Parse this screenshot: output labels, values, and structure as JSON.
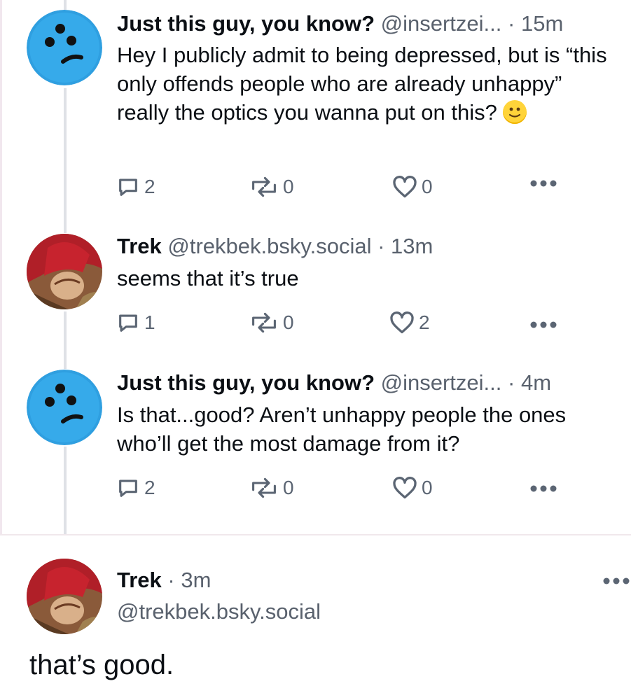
{
  "posts": [
    {
      "name": "Just this guy, you know?",
      "handle": "@insertzei...",
      "time": "15m",
      "text": "Hey I publicly admit to being depressed, but is “this only offends people who are already unhappy” really the optics you wanna put on this?",
      "replies": "2",
      "reposts": "0",
      "likes": "0"
    },
    {
      "name": "Trek",
      "handle": "@trekbek.bsky.social",
      "time": "13m",
      "text": "seems that it’s true",
      "replies": "1",
      "reposts": "0",
      "likes": "2"
    },
    {
      "name": "Just this guy, you know?",
      "handle": "@insertzei...",
      "time": "4m",
      "text": "Is that...good? Aren’t unhappy people the ones who’ll get the most damage from it?",
      "replies": "2",
      "reposts": "0",
      "likes": "0"
    }
  ],
  "focused": {
    "name": "Trek",
    "time": "3m",
    "handle": "@trekbek.bsky.social",
    "text": "that’s good."
  },
  "separator": "·",
  "icons": {
    "reply": "speech-bubble-icon",
    "repost": "repost-arrows-icon",
    "like": "heart-outline-icon",
    "more": "more-dots-icon",
    "emoji": "slightly-smiling-face-emoji"
  },
  "colors": {
    "text": "#0b0f14",
    "muted": "#59616d",
    "avatar_blue": "#2f9fe0",
    "thread_line": "#dfe1e6"
  }
}
